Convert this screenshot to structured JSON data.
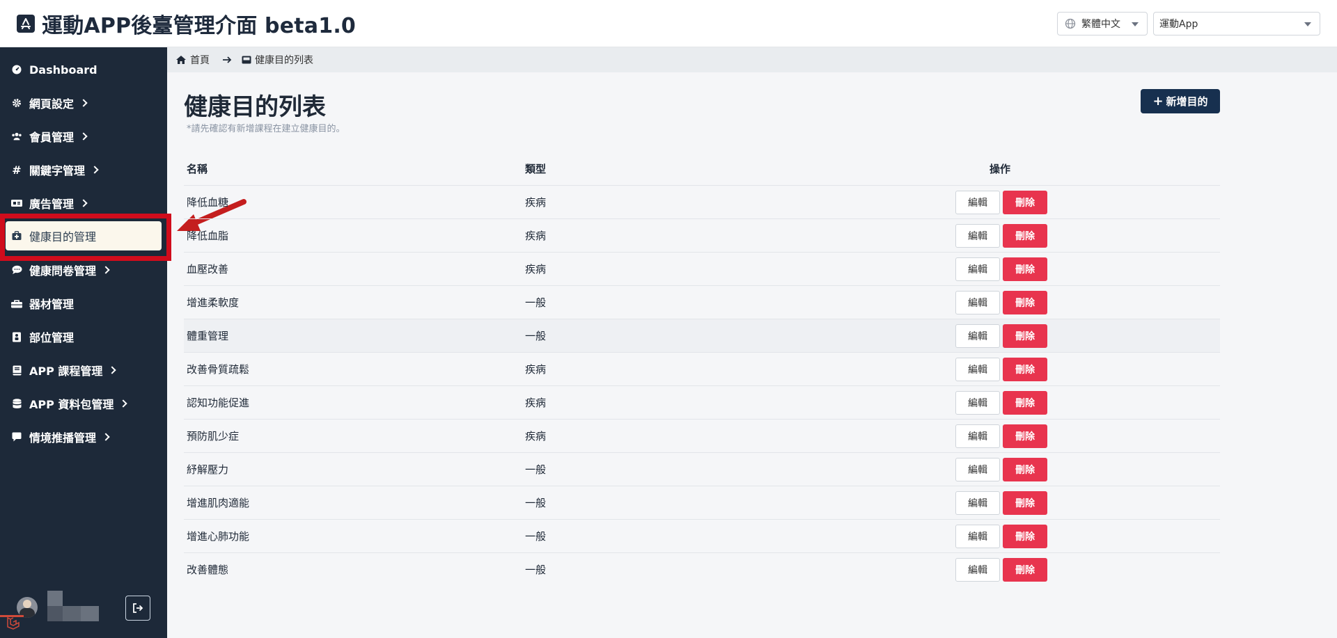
{
  "header": {
    "title": "運動APP後臺管理介面 beta1.0",
    "language": "繁體中文",
    "app": "運動App"
  },
  "sidebar": {
    "items": [
      {
        "label": "Dashboard",
        "icon": "dashboard-icon",
        "has_children": false
      },
      {
        "label": "網頁設定",
        "icon": "gear-icon",
        "has_children": true
      },
      {
        "label": "會員管理",
        "icon": "users-icon",
        "has_children": true
      },
      {
        "label": "關鍵字管理",
        "icon": "hashtag-icon",
        "has_children": true
      },
      {
        "label": "廣告管理",
        "icon": "ad-icon",
        "has_children": true
      },
      {
        "label": "健康目的管理",
        "icon": "medical-kit-icon",
        "has_children": false,
        "active": true
      },
      {
        "label": "健康問卷管理",
        "icon": "comment-icon",
        "has_children": true
      },
      {
        "label": "器材管理",
        "icon": "toolbox-icon",
        "has_children": false
      },
      {
        "label": "部位管理",
        "icon": "body-part-icon",
        "has_children": false
      },
      {
        "label": "APP 課程管理",
        "icon": "book-icon",
        "has_children": true
      },
      {
        "label": "APP 資料包管理",
        "icon": "database-icon",
        "has_children": true
      },
      {
        "label": "情境推播管理",
        "icon": "message-icon",
        "has_children": true
      }
    ]
  },
  "breadcrumb": {
    "home": "首頁",
    "current": "健康目的列表"
  },
  "page": {
    "title": "健康目的列表",
    "note": "*請先確認有新增課程在建立健康目的。",
    "add_button": "新增目的"
  },
  "table": {
    "headers": {
      "name": "名稱",
      "type": "類型",
      "actions": "操作"
    },
    "edit_label": "編輯",
    "delete_label": "刪除",
    "rows": [
      {
        "name": "降低血糖",
        "type": "疾病"
      },
      {
        "name": "降低血脂",
        "type": "疾病"
      },
      {
        "name": "血壓改善",
        "type": "疾病"
      },
      {
        "name": "增進柔軟度",
        "type": "一般"
      },
      {
        "name": "體重管理",
        "type": "一般"
      },
      {
        "name": "改善骨質疏鬆",
        "type": "疾病"
      },
      {
        "name": "認知功能促進",
        "type": "疾病"
      },
      {
        "name": "預防肌少症",
        "type": "疾病"
      },
      {
        "name": "紓解壓力",
        "type": "一般"
      },
      {
        "name": "增進肌肉適能",
        "type": "一般"
      },
      {
        "name": "增進心肺功能",
        "type": "一般"
      },
      {
        "name": "改善體態",
        "type": "一般"
      }
    ]
  },
  "colors": {
    "sidebar_bg": "#1d2939",
    "primary": "#17304f",
    "danger": "#e8344e",
    "annotation": "#d00c1c"
  }
}
